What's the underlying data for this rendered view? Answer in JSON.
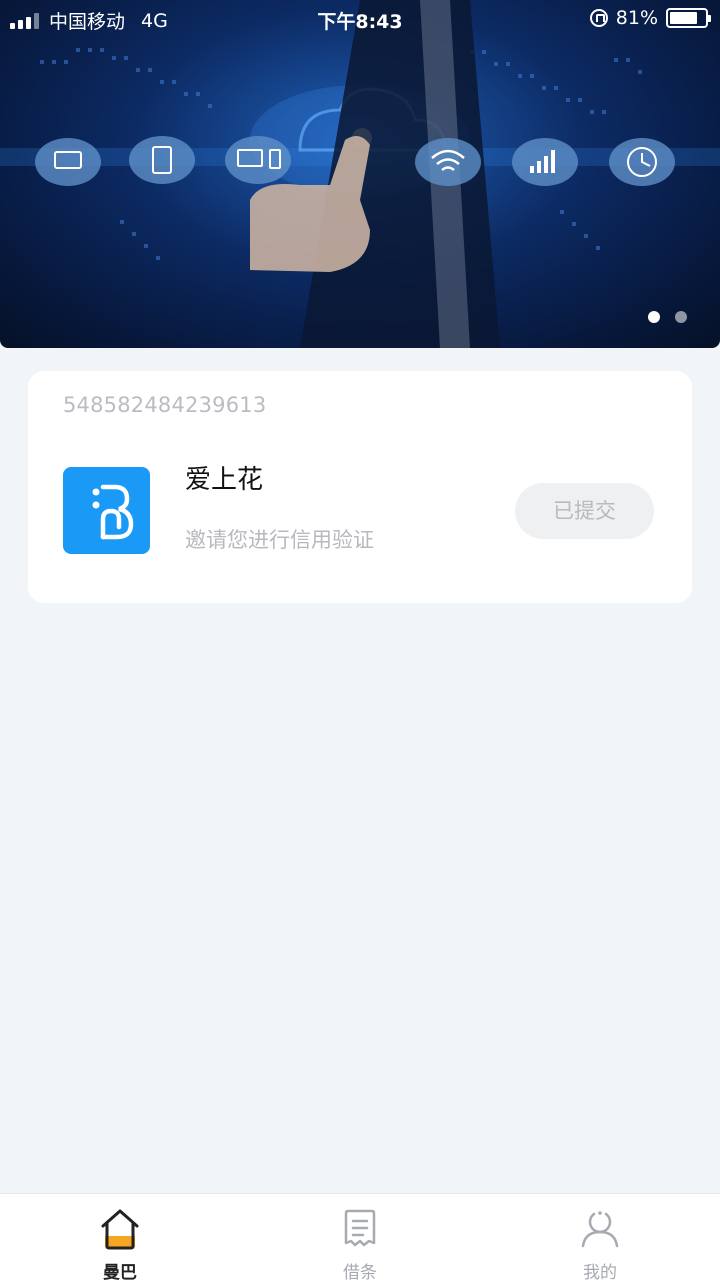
{
  "status_bar": {
    "carrier": "中国移动",
    "network": "4G",
    "time": "下午8:43",
    "battery": "81%"
  },
  "banner": {
    "slides_total": 2,
    "active_slide": 1,
    "icons": [
      "laptop-icon",
      "tablet-icon",
      "desktop-icon",
      "wifi-icon",
      "signal-icon",
      "clock-icon"
    ]
  },
  "card": {
    "id_number": "548582484239613",
    "app_name": "爱上花",
    "description": "邀请您进行信用验证",
    "status_button": "已提交",
    "logo_color": "#1a9af6"
  },
  "tabbar": {
    "tabs": [
      {
        "label": "曼巴",
        "icon": "home-icon",
        "active": true
      },
      {
        "label": "借条",
        "icon": "document-icon",
        "active": false
      },
      {
        "label": "我的",
        "icon": "user-icon",
        "active": false
      }
    ],
    "accent_color": "#f5a623"
  }
}
